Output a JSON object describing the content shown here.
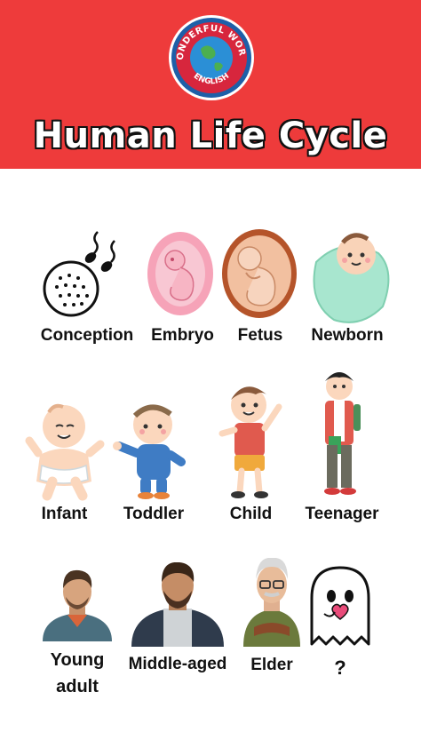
{
  "brand": {
    "top_text": "WONDERFUL WORLD",
    "bottom_text": "ENGLISH",
    "colors": {
      "ring": "#1e5fa8",
      "inner": "#ffffff",
      "globe": "#2b8fd6",
      "land": "#4caf50"
    }
  },
  "title": "Human Life Cycle",
  "colors": {
    "header": "#ee3b3b",
    "background": "#ffffff",
    "text": "#111111"
  },
  "stages": [
    {
      "label": "Conception",
      "icon": "sperm-egg-icon"
    },
    {
      "label": "Embryo",
      "icon": "embryo-icon"
    },
    {
      "label": "Fetus",
      "icon": "fetus-icon"
    },
    {
      "label": "Newborn",
      "icon": "newborn-icon"
    },
    {
      "label": "Infant",
      "icon": "infant-icon"
    },
    {
      "label": "Toddler",
      "icon": "toddler-icon"
    },
    {
      "label": "Child",
      "icon": "child-icon"
    },
    {
      "label": "Teenager",
      "icon": "teenager-icon"
    },
    {
      "label": "Young adult",
      "icon": "young-adult-icon"
    },
    {
      "label": "Middle-aged",
      "icon": "middle-aged-icon"
    },
    {
      "label": "Elder",
      "icon": "elder-icon"
    },
    {
      "label": "?",
      "icon": "ghost-icon"
    }
  ]
}
